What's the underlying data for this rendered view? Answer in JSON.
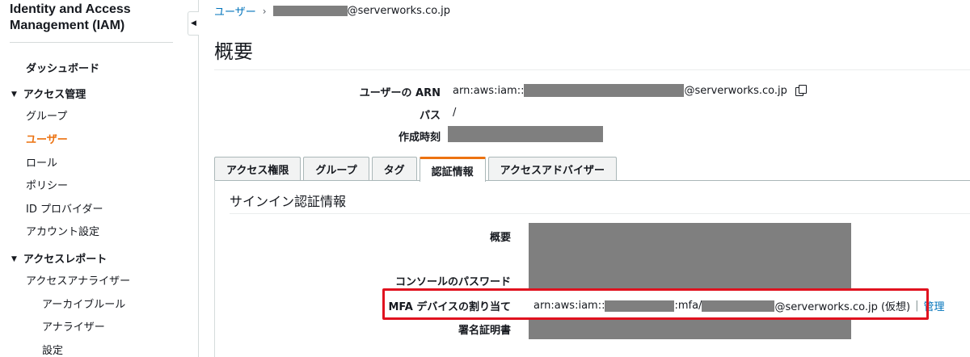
{
  "sidebar": {
    "title": "Identity and Access Management (IAM)",
    "dashboard": "ダッシュボード",
    "access_management": {
      "label": "アクセス管理",
      "items": [
        "グループ",
        "ユーザー",
        "ロール",
        "ポリシー",
        "ID プロバイダー",
        "アカウント設定"
      ],
      "active": "ユーザー"
    },
    "access_reports": {
      "label": "アクセスレポート",
      "analyzer": "アクセスアナライザー",
      "sub_items": [
        "アーカイブルール",
        "アナライザー",
        "設定"
      ]
    }
  },
  "breadcrumb": {
    "users_link": "ユーザー",
    "current_suffix": "@serverworks.co.jp"
  },
  "page_title": "概要",
  "summary": {
    "arn_label": "ユーザーの ARN",
    "arn_prefix": "arn:aws:iam::",
    "arn_suffix": "@serverworks.co.jp",
    "path_label": "パス",
    "path_value": "/",
    "created_label": "作成時刻"
  },
  "tabs": [
    "アクセス権限",
    "グループ",
    "タグ",
    "認証情報",
    "アクセスアドバイザー"
  ],
  "active_tab": "認証情報",
  "credentials": {
    "section_title": "サインイン認証情報",
    "summary_label": "概要",
    "console_password_label": "コンソールのパスワード",
    "mfa_label": "MFA デバイスの割り当て",
    "mfa_prefix": "arn:aws:iam::",
    "mfa_middle": ":mfa/",
    "mfa_suffix": "@serverworks.co.jp (仮想)",
    "mfa_manage_link": "管理",
    "signing_cert_label": "署名証明書"
  },
  "colors": {
    "accent": "#ec7211",
    "link": "#0073bb",
    "highlight_border": "#e0121f",
    "redaction": "#7f7f7f"
  }
}
